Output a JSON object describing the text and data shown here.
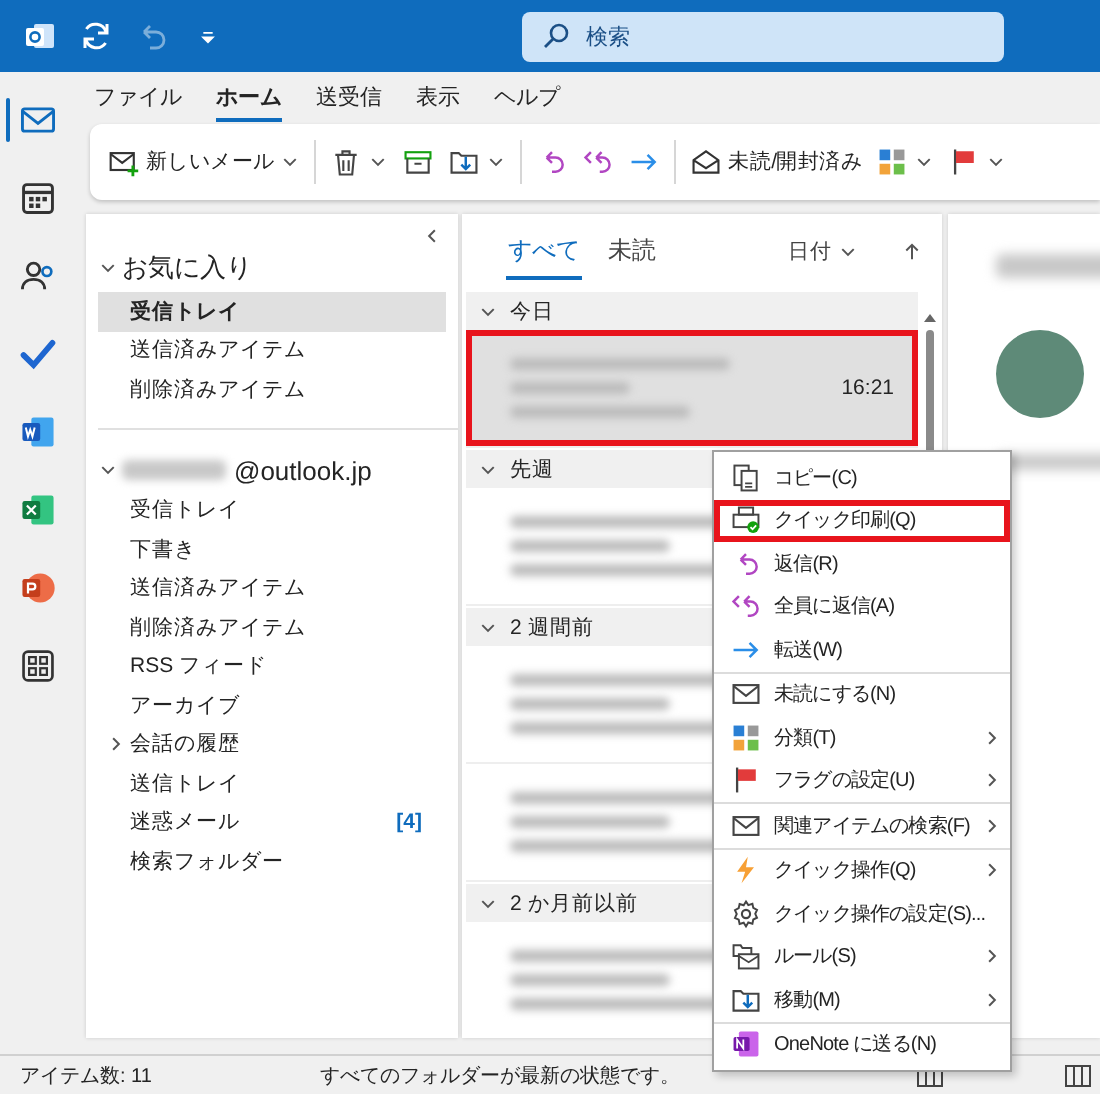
{
  "title_bar": {
    "quick_access": [
      {
        "kind": "app",
        "disabled": false
      },
      {
        "kind": "sync",
        "disabled": false
      },
      {
        "kind": "undo",
        "disabled": true
      },
      {
        "kind": "customize",
        "disabled": false
      }
    ],
    "search": {
      "placeholder": "検索"
    }
  },
  "app_rail": [
    {
      "kind": "mail",
      "selected": true
    },
    {
      "kind": "calendar",
      "selected": false
    },
    {
      "kind": "people",
      "selected": false
    },
    {
      "kind": "todo",
      "selected": false
    },
    {
      "kind": "word",
      "selected": false
    },
    {
      "kind": "excel",
      "selected": false
    },
    {
      "kind": "powerpoint",
      "selected": false
    },
    {
      "kind": "apps",
      "selected": false
    }
  ],
  "menu_tabs": [
    {
      "label": "ファイル",
      "selected": false
    },
    {
      "label": "ホーム",
      "selected": true
    },
    {
      "label": "送受信",
      "selected": false
    },
    {
      "label": "表示",
      "selected": false
    },
    {
      "label": "ヘルプ",
      "selected": false
    }
  ],
  "ribbon": [
    {
      "kind": "new_mail",
      "label": "新しいメール",
      "dropdown": true
    },
    {
      "kind": "divider"
    },
    {
      "kind": "delete",
      "dropdown": true
    },
    {
      "kind": "archive",
      "dropdown": false
    },
    {
      "kind": "move",
      "dropdown": true
    },
    {
      "kind": "divider"
    },
    {
      "kind": "reply",
      "dropdown": false
    },
    {
      "kind": "reply_all",
      "dropdown": false
    },
    {
      "kind": "forward",
      "dropdown": false
    },
    {
      "kind": "divider"
    },
    {
      "kind": "read_unread",
      "label": "未読/開封済み",
      "dropdown": false
    },
    {
      "kind": "categorize",
      "dropdown": true
    },
    {
      "kind": "flag",
      "dropdown": true
    }
  ],
  "folder_pane": {
    "favorites": {
      "title": "お気に入り",
      "expanded": true,
      "items": [
        {
          "label": "受信トレイ",
          "selected": true
        },
        {
          "label": "送信済みアイテム",
          "selected": false
        },
        {
          "label": "削除済みアイテム",
          "selected": false
        }
      ]
    },
    "account": {
      "name": "@outlook.jp",
      "expanded": true,
      "folders": [
        {
          "label": "受信トレイ",
          "selected": false,
          "has_children": false
        },
        {
          "label": "下書き",
          "selected": false,
          "has_children": false
        },
        {
          "label": "送信済みアイテム",
          "selected": false,
          "has_children": false
        },
        {
          "label": "削除済みアイテム",
          "selected": false,
          "has_children": false
        },
        {
          "label": "RSS フィード",
          "selected": false,
          "has_children": false
        },
        {
          "label": "アーカイブ",
          "selected": false,
          "has_children": false
        },
        {
          "label": "会話の履歴",
          "selected": false,
          "has_children": true
        },
        {
          "label": "送信トレイ",
          "selected": false,
          "has_children": false
        },
        {
          "label": "迷惑メール",
          "selected": false,
          "has_children": false,
          "count": "[4]"
        },
        {
          "label": "検索フォルダー",
          "selected": false,
          "has_children": false
        }
      ]
    }
  },
  "message_list": {
    "tabs": [
      {
        "label": "すべて",
        "selected": true
      },
      {
        "label": "未読",
        "selected": false
      }
    ],
    "sort": {
      "label": "日付"
    },
    "groups": [
      {
        "title": "今日",
        "expanded": true,
        "messages": [
          {
            "time": "16:21",
            "selected": true,
            "highlighted": true
          }
        ]
      },
      {
        "title": "先週",
        "expanded": true,
        "messages": [
          {
            "selected": false,
            "highlighted": false
          }
        ]
      },
      {
        "title": "2 週間前",
        "expanded": true,
        "messages": [
          {
            "selected": false,
            "highlighted": false
          },
          {
            "selected": false,
            "highlighted": false
          }
        ]
      },
      {
        "title": "2 か月前以前",
        "expanded": true,
        "messages": [
          {
            "selected": false,
            "highlighted": false
          }
        ]
      }
    ]
  },
  "context_menu": {
    "items": [
      {
        "kind": "copy",
        "label": "コピー(C)",
        "highlighted": false,
        "submenu": false,
        "separator_before": false
      },
      {
        "kind": "quick_print",
        "label": "クイック印刷(Q)",
        "highlighted": true,
        "submenu": false,
        "separator_before": false
      },
      {
        "kind": "reply",
        "label": "返信(R)",
        "highlighted": false,
        "submenu": false,
        "separator_before": false
      },
      {
        "kind": "reply_all",
        "label": "全員に返信(A)",
        "highlighted": false,
        "submenu": false,
        "separator_before": false
      },
      {
        "kind": "forward",
        "label": "転送(W)",
        "highlighted": false,
        "submenu": false,
        "separator_before": false
      },
      {
        "kind": "unread",
        "label": "未読にする(N)",
        "highlighted": false,
        "submenu": false,
        "separator_before": true
      },
      {
        "kind": "categorize",
        "label": "分類(T)",
        "highlighted": false,
        "submenu": true,
        "separator_before": false
      },
      {
        "kind": "flag",
        "label": "フラグの設定(U)",
        "highlighted": false,
        "submenu": true,
        "separator_before": false
      },
      {
        "kind": "find_related",
        "label": "関連アイテムの検索(F)",
        "highlighted": false,
        "submenu": true,
        "separator_before": true
      },
      {
        "kind": "quick_steps",
        "label": "クイック操作(Q)",
        "highlighted": false,
        "submenu": true,
        "separator_before": true
      },
      {
        "kind": "settings",
        "label": "クイック操作の設定(S)...",
        "highlighted": false,
        "submenu": false,
        "separator_before": false
      },
      {
        "kind": "rules",
        "label": "ルール(S)",
        "highlighted": false,
        "submenu": true,
        "separator_before": false
      },
      {
        "kind": "move",
        "label": "移動(M)",
        "highlighted": false,
        "submenu": true,
        "separator_before": false
      },
      {
        "kind": "onenote",
        "label": "OneNote に送る(N)",
        "highlighted": false,
        "submenu": false,
        "separator_before": true
      }
    ]
  },
  "status_bar": {
    "item_count": "アイテム数: 11",
    "sync_status": "すべてのフォルダーが最新の状態です。"
  }
}
